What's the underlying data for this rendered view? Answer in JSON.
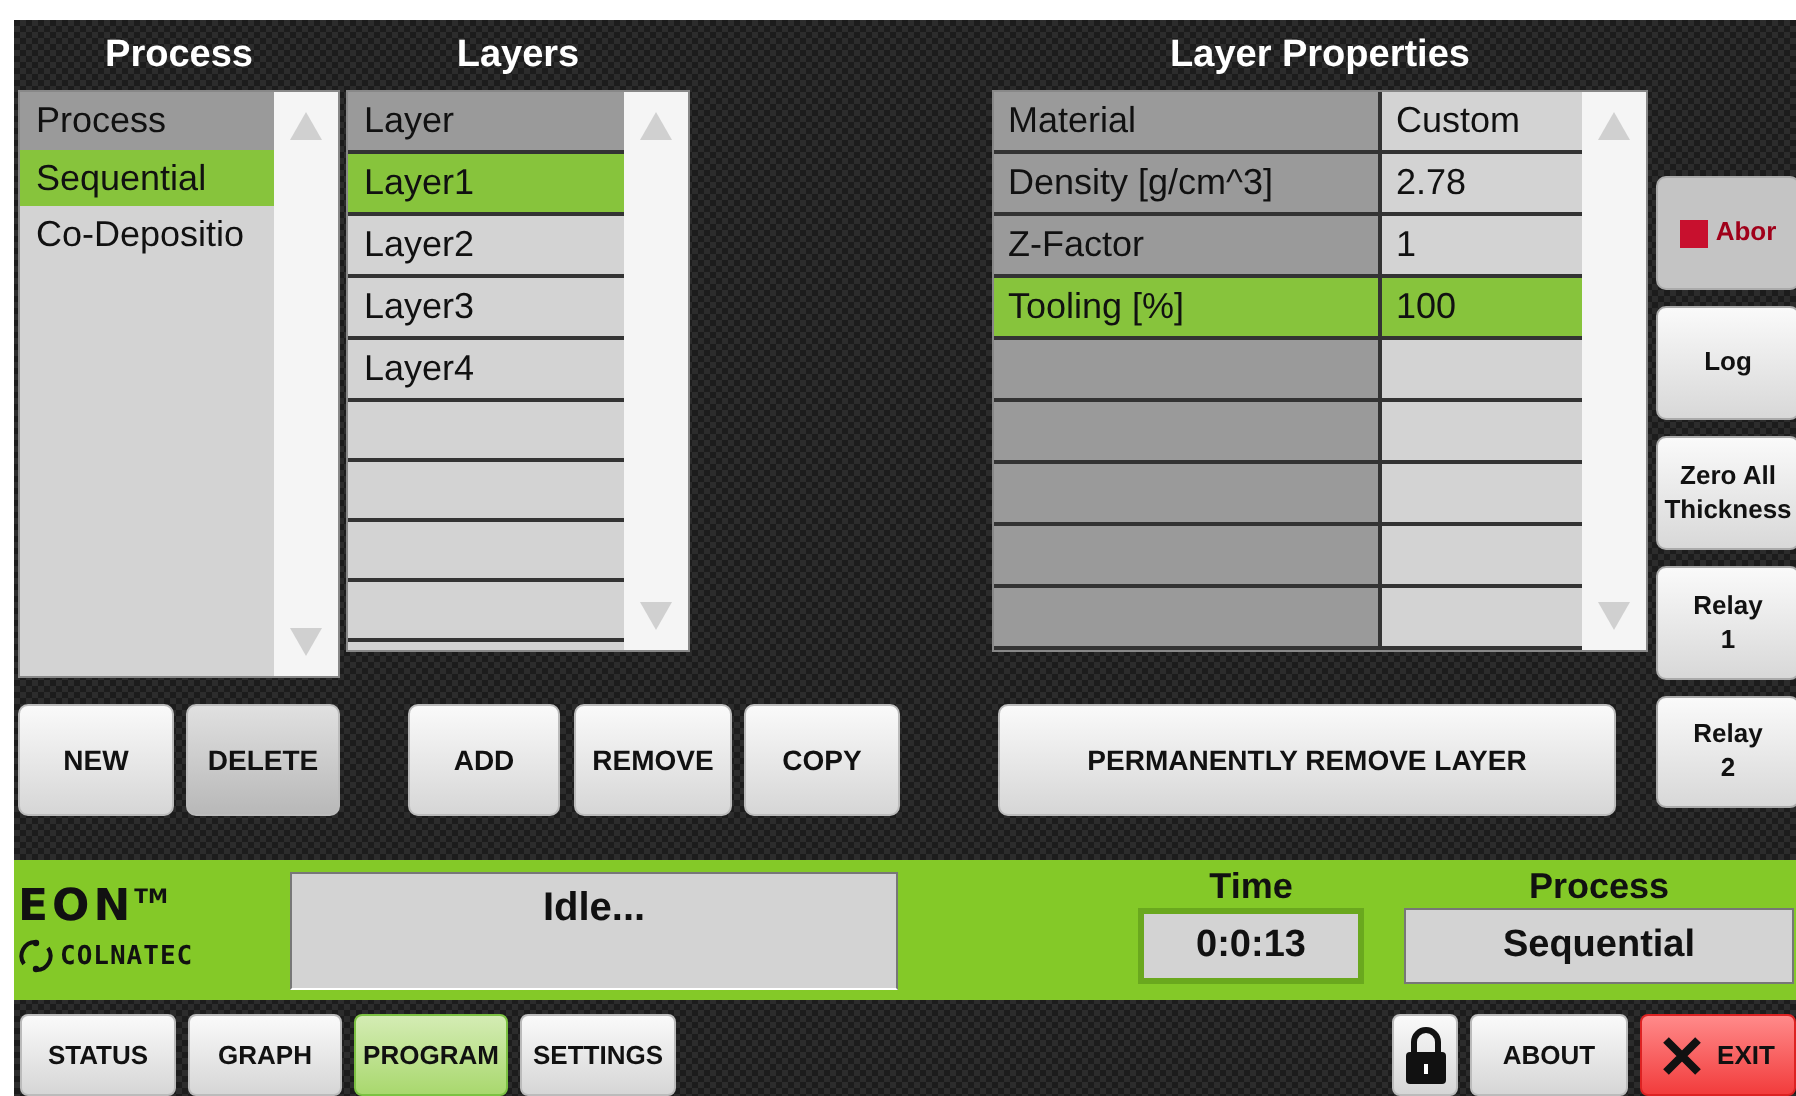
{
  "titles": {
    "process": "Process",
    "layers": "Layers",
    "properties": "Layer Properties"
  },
  "process_list": {
    "header": "Process",
    "items": [
      {
        "label": "Sequential",
        "selected": true
      },
      {
        "label": "Co-Depositio",
        "selected": false
      }
    ]
  },
  "layers_list": {
    "header": "Layer",
    "items": [
      {
        "label": "Layer1",
        "selected": true
      },
      {
        "label": "Layer2",
        "selected": false
      },
      {
        "label": "Layer3",
        "selected": false
      },
      {
        "label": "Layer4",
        "selected": false
      }
    ]
  },
  "properties": {
    "rows": [
      {
        "name": "Material",
        "value": "Custom",
        "selected": false
      },
      {
        "name": "Density [g/cm^3]",
        "value": "2.78",
        "selected": false
      },
      {
        "name": "Z-Factor",
        "value": "1",
        "selected": false
      },
      {
        "name": "Tooling [%]",
        "value": "100",
        "selected": true
      }
    ]
  },
  "side_buttons": [
    {
      "kind": "abort",
      "label": "Abor",
      "disabled": true
    },
    {
      "kind": "plain",
      "label": "Log",
      "disabled": false
    },
    {
      "kind": "plain",
      "label": "Zero All\nThickness",
      "disabled": false
    },
    {
      "kind": "plain",
      "label": "Relay\n1",
      "disabled": false
    },
    {
      "kind": "plain",
      "label": "Relay\n2",
      "disabled": false
    }
  ],
  "process_buttons": [
    {
      "label": "NEW",
      "pressed": false
    },
    {
      "label": "DELETE",
      "pressed": true
    }
  ],
  "layer_buttons": [
    {
      "label": "ADD",
      "pressed": false
    },
    {
      "label": "REMOVE",
      "pressed": false
    },
    {
      "label": "COPY",
      "pressed": false
    }
  ],
  "property_buttons": [
    {
      "label": "PERMANENTLY REMOVE LAYER",
      "pressed": false
    }
  ],
  "status_bar": {
    "logo": {
      "name": "EON",
      "mark": "TM",
      "company": "COLNATEC"
    },
    "status": "Idle...",
    "time_label": "Time",
    "time": "0:0:13",
    "process_label": "Process",
    "process": "Sequential"
  },
  "nav_tabs": [
    {
      "label": "STATUS",
      "selected": false
    },
    {
      "label": "GRAPH",
      "selected": false
    },
    {
      "label": "PROGRAM",
      "selected": true
    },
    {
      "label": "SETTINGS",
      "selected": false
    }
  ],
  "footer_buttons": [
    {
      "kind": "lock"
    },
    {
      "kind": "plain",
      "label": "ABOUT"
    },
    {
      "kind": "exit",
      "label": "EXIT"
    }
  ]
}
